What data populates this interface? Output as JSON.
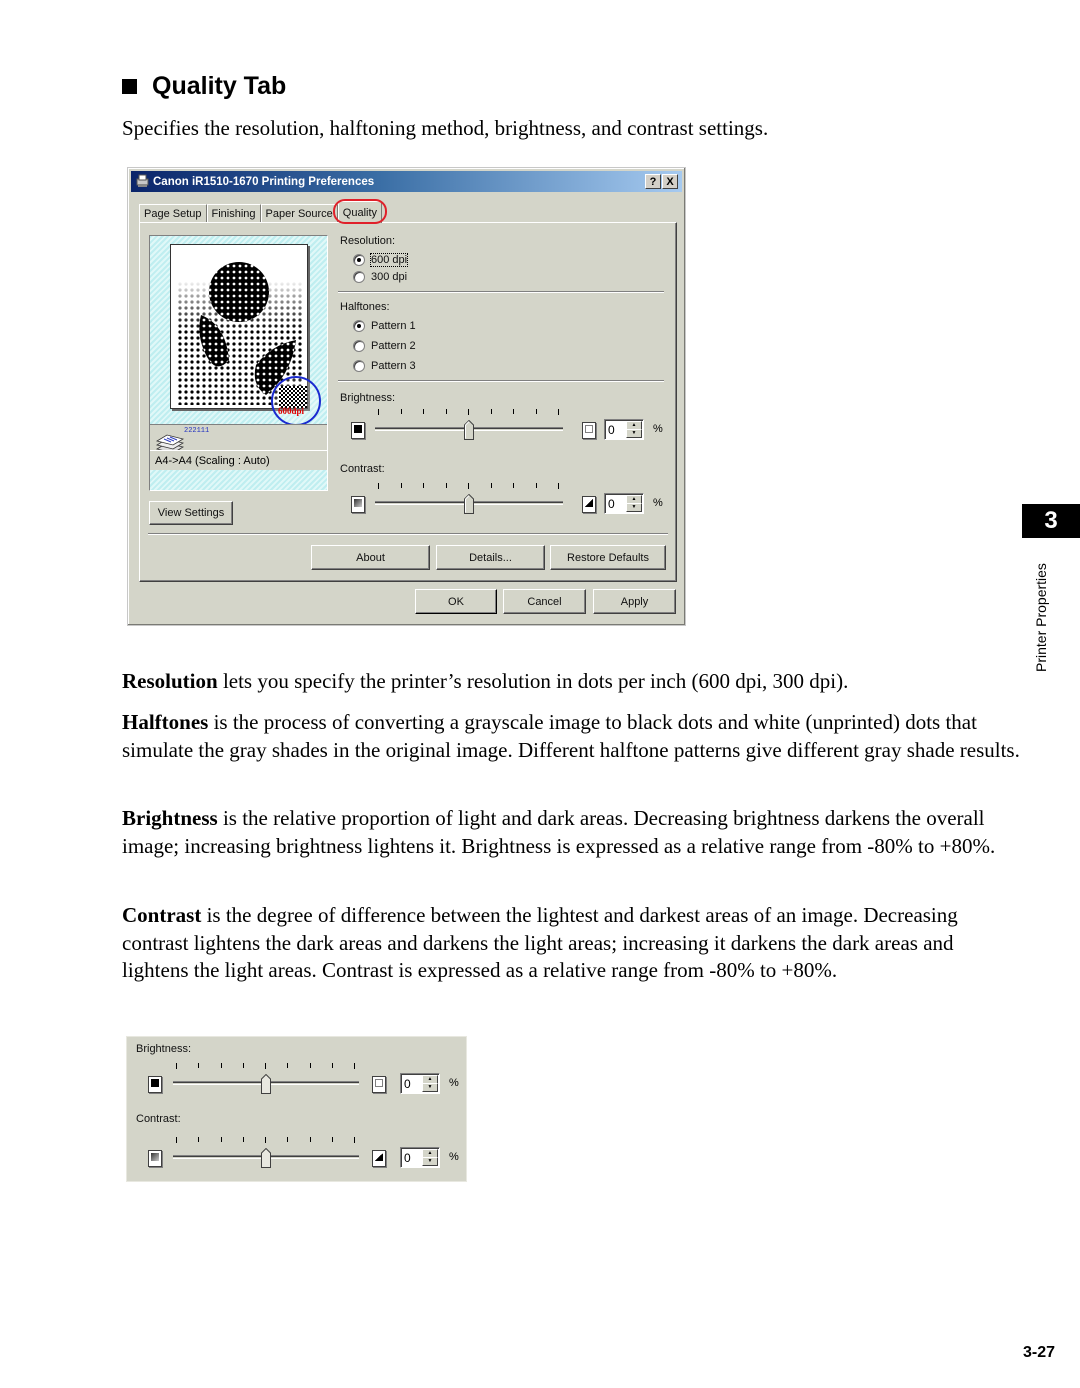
{
  "heading": "Quality Tab",
  "intro": "Specifies the resolution, halftoning method, brightness, and contrast settings.",
  "dialog": {
    "title": "Canon iR1510-1670 Printing Preferences",
    "help_button": "?",
    "close_button": "X",
    "tabs": [
      {
        "label": "Page Setup",
        "active": false
      },
      {
        "label": "Finishing",
        "active": false
      },
      {
        "label": "Paper Source",
        "active": false
      },
      {
        "label": "Quality",
        "active": true
      }
    ],
    "highlight_color": "#e0202a",
    "preview": {
      "badge_text": "600dpi",
      "copies_text": "222111",
      "scaling_text": "A4->A4 (Scaling : Auto)",
      "view_settings_button": "View Settings"
    },
    "resolution": {
      "label": "Resolution:",
      "options": [
        {
          "label": "600 dpi",
          "selected": true
        },
        {
          "label": "300 dpi",
          "selected": false
        }
      ]
    },
    "halftones": {
      "label": "Halftones:",
      "options": [
        {
          "label": "Pattern 1",
          "selected": true
        },
        {
          "label": "Pattern 2",
          "selected": false
        },
        {
          "label": "Pattern 3",
          "selected": false
        }
      ]
    },
    "brightness": {
      "label": "Brightness:",
      "value": "0",
      "unit": "%",
      "slider_fraction": 0.5,
      "tick_count": 9
    },
    "contrast": {
      "label": "Contrast:",
      "value": "0",
      "unit": "%",
      "slider_fraction": 0.5,
      "tick_count": 9
    },
    "buttons": {
      "about": "About",
      "details": "Details...",
      "restore_defaults": "Restore Defaults",
      "ok": "OK",
      "cancel": "Cancel",
      "apply": "Apply"
    }
  },
  "paragraphs": [
    {
      "term": "Resolution",
      "text": " lets you specify the printer’s resolution in dots per inch (600 dpi, 300 dpi)."
    },
    {
      "term": "Halftones",
      "text": " is the process of converting a grayscale image to black dots and white (unprinted) dots that simulate the gray shades in the original image. Different halftone patterns give different gray shade results."
    },
    {
      "term": "Brightness",
      "text": " is the relative proportion of light and dark areas. Decreasing brightness darkens the overall image; increasing brightness lightens it. Brightness is expressed as a relative range from -80% to +80%."
    },
    {
      "term": "Contrast",
      "text": " is the degree of difference between the lightest and darkest areas of an image. Decreasing contrast lightens the dark areas and darkens the light areas; increasing it darkens the dark areas and lightens the light areas. Contrast is expressed as a relative range from -80% to +80%."
    }
  ],
  "detail_panel": {
    "brightness": {
      "label": "Brightness:",
      "value": "0",
      "unit": "%",
      "slider_fraction": 0.5
    },
    "contrast": {
      "label": "Contrast:",
      "value": "0",
      "unit": "%",
      "slider_fraction": 0.5
    }
  },
  "chapter": {
    "number": "3",
    "label": "Printer Properties"
  },
  "page_number": "3-27"
}
